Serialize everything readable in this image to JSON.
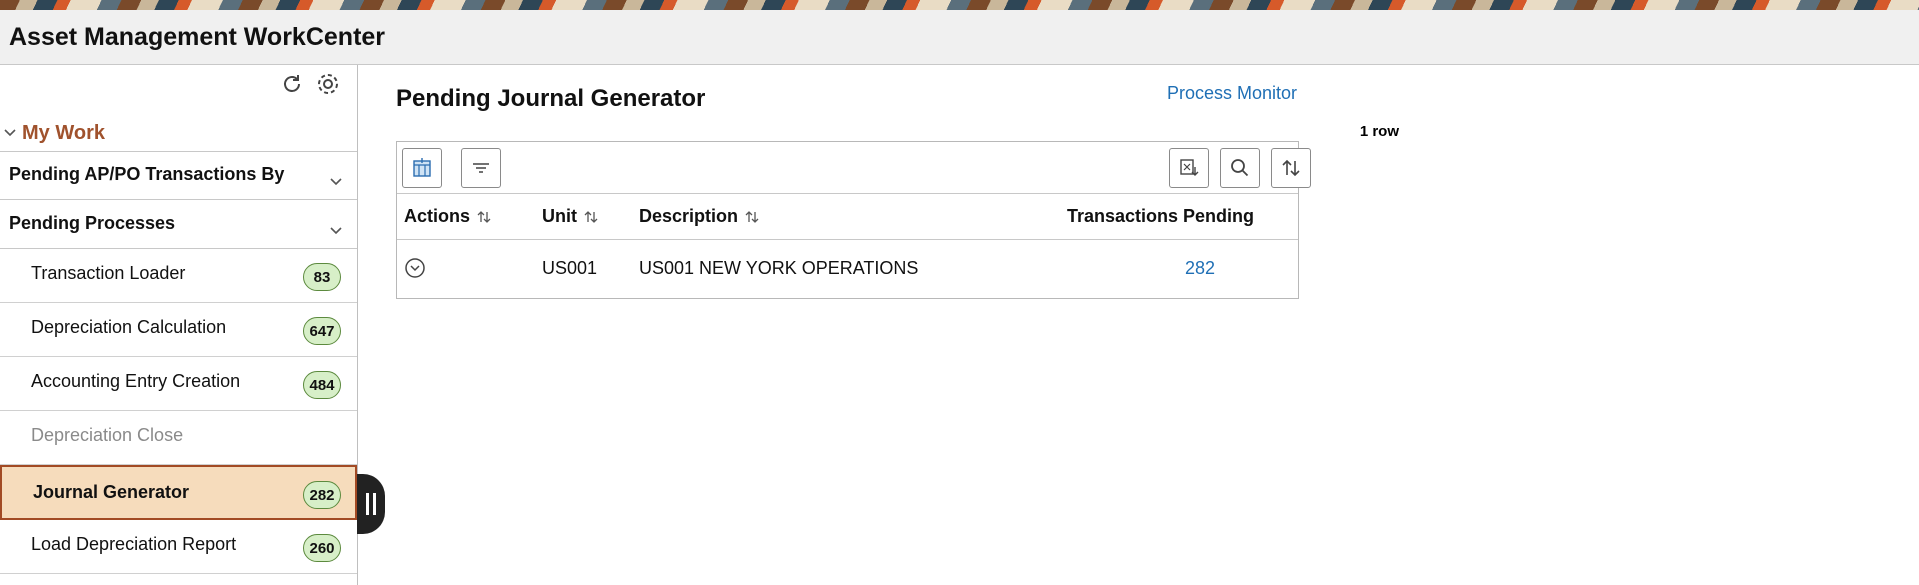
{
  "header": {
    "title": "Asset Management WorkCenter"
  },
  "left_panel": {
    "refresh_icon": "refresh-icon",
    "settings_icon": "gear-icon",
    "section": "My Work",
    "groups": [
      {
        "label": "Pending AP/PO Transactions By"
      },
      {
        "label": "Pending Processes"
      }
    ],
    "items": [
      {
        "label": "Transaction Loader",
        "count": "83"
      },
      {
        "label": "Depreciation Calculation",
        "count": "647"
      },
      {
        "label": "Accounting Entry Creation",
        "count": "484"
      },
      {
        "label": "Depreciation Close",
        "count": ""
      },
      {
        "label": "Journal Generator",
        "count": "282"
      },
      {
        "label": "Load Depreciation Report",
        "count": "260"
      }
    ]
  },
  "main": {
    "title": "Pending Journal Generator",
    "process_monitor": "Process Monitor",
    "row_count": "1 row",
    "columns": {
      "actions": "Actions",
      "unit": "Unit",
      "description": "Description",
      "pending": "Transactions Pending"
    },
    "rows": [
      {
        "unit": "US001",
        "description": "US001 NEW YORK OPERATIONS",
        "pending": "282"
      }
    ]
  },
  "colors": {
    "accent": "#a0522d",
    "link": "#1f6fb5",
    "selected_bg": "#f6dcbc",
    "badge_bg": "#d7efc8"
  }
}
